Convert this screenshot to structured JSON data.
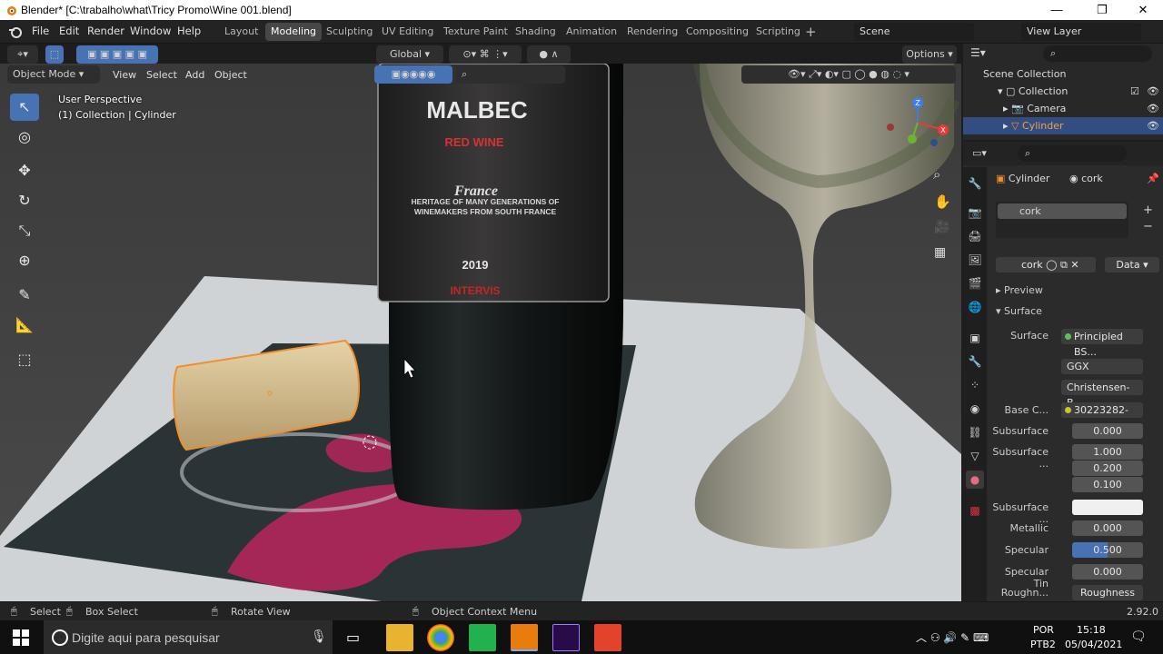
{
  "window": {
    "title": "Blender* [C:\\trabalho\\what\\Tricy Promo\\Wine 001.blend]",
    "min": "—",
    "max": "❐",
    "close": "✕"
  },
  "menu": {
    "items": [
      "File",
      "Edit",
      "Render",
      "Window",
      "Help"
    ]
  },
  "workspaces": [
    "Layout",
    "Modeling",
    "Sculpting",
    "UV Editing",
    "Texture Paint",
    "Shading",
    "Animation",
    "Rendering",
    "Compositing",
    "Scripting"
  ],
  "active_workspace": "Modeling",
  "scene": "Scene",
  "view_layer": "View Layer",
  "viewport_header": {
    "mode": "Object Mode",
    "menus": [
      "View",
      "Select",
      "Add",
      "Object"
    ],
    "orientation": "Global",
    "options": "Options"
  },
  "viewport": {
    "perspective": "User Perspective",
    "collection_info": "(1) Collection | Cylinder",
    "bottle_label": {
      "brand": "MALBEC",
      "type": "RED WINE",
      "origin": "France",
      "tagline": "HERITAGE OF MANY GENERATIONS OF WINEMAKERS FROM SOUTH FRANCE",
      "year": "2019",
      "maker": "INTERVIS"
    }
  },
  "outliner": {
    "root": "Scene Collection",
    "collection": "Collection",
    "items": [
      "Camera",
      "Cylinder"
    ]
  },
  "properties": {
    "object": "Cylinder",
    "material": "cork",
    "slot": "cork",
    "data_label": "Data",
    "sections": {
      "preview": "Preview",
      "surface": "Surface"
    },
    "surface_shader": "Principled BS...",
    "distribution": "GGX",
    "subsurface_method": "Christensen-B...",
    "rows": [
      {
        "label": "Base C...",
        "value": "30223282-c..."
      },
      {
        "label": "Subsurface",
        "value": "0.000"
      },
      {
        "label": "Subsurface ...",
        "value": "1.000"
      },
      {
        "label": "",
        "value": "0.200"
      },
      {
        "label": "",
        "value": "0.100"
      },
      {
        "label": "Subsurface ...",
        "value": ""
      },
      {
        "label": "Metallic",
        "value": "0.000"
      },
      {
        "label": "Specular",
        "value": "0.500"
      },
      {
        "label": "Specular Tin",
        "value": "0.000"
      },
      {
        "label": "Roughn...",
        "value": "Roughness"
      }
    ],
    "surface_label": "Surface"
  },
  "statusbar": {
    "select": "Select",
    "box_select": "Box Select",
    "rotate": "Rotate View",
    "context": "Object Context Menu",
    "version": "2.92.0"
  },
  "taskbar": {
    "search_placeholder": "Digite aqui para pesquisar",
    "lang": "POR",
    "layout": "PTB2",
    "time": "15:18",
    "date": "05/04/2021"
  },
  "colors": {
    "accent": "#4772b3",
    "active_ws": "#474747",
    "selected_row": "#334d80",
    "wine": "#b3265c"
  }
}
